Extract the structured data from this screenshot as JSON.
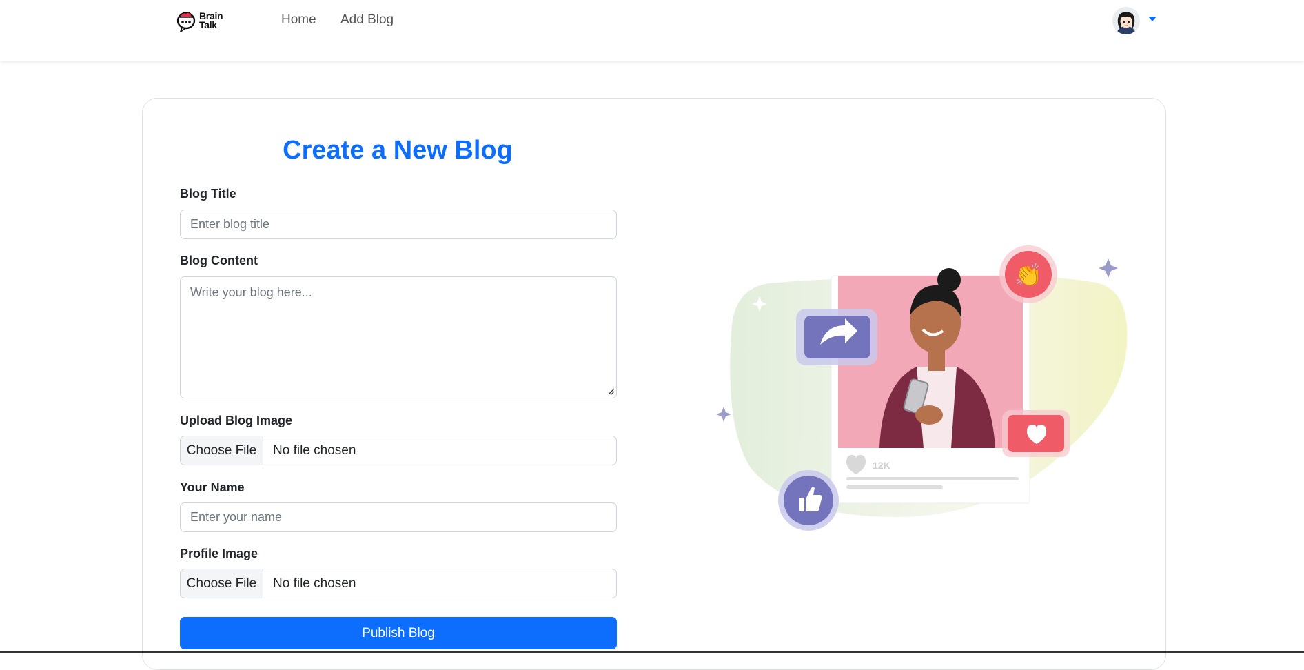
{
  "nav": {
    "logo_line1": "Brain",
    "logo_line2": "Talk",
    "links": [
      {
        "label": "Home"
      },
      {
        "label": "Add Blog"
      }
    ]
  },
  "form": {
    "title": "Create a New Blog",
    "blog_title": {
      "label": "Blog Title",
      "placeholder": "Enter blog title",
      "value": ""
    },
    "blog_content": {
      "label": "Blog Content",
      "placeholder": "Write your blog here...",
      "value": ""
    },
    "blog_image": {
      "label": "Upload Blog Image",
      "button": "Choose File",
      "status": "No file chosen"
    },
    "your_name": {
      "label": "Your Name",
      "placeholder": "Enter your name",
      "value": ""
    },
    "profile_image": {
      "label": "Profile Image",
      "button": "Choose File",
      "status": "No file chosen"
    },
    "submit_label": "Publish Blog"
  },
  "illustration": {
    "likes_count": "12K"
  },
  "colors": {
    "accent": "#0d6efd",
    "pink": "#f2a8b6",
    "purple": "#7474bd",
    "red": "#ef5b67"
  }
}
